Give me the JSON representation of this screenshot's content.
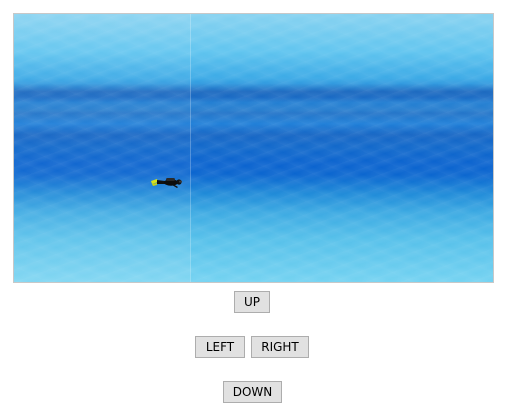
{
  "game": {
    "scene": "underwater-ocean",
    "player": {
      "icon": "scuba-diver-icon"
    }
  },
  "controls": {
    "up_label": "UP",
    "left_label": "LEFT",
    "right_label": "RIGHT",
    "down_label": "DOWN"
  },
  "colors": {
    "water_light": "#73d2f1",
    "water_mid": "#1f7fd8",
    "water_deep": "#0a63cf",
    "button_bg": "#e1e1e1",
    "button_border": "#adadad"
  }
}
